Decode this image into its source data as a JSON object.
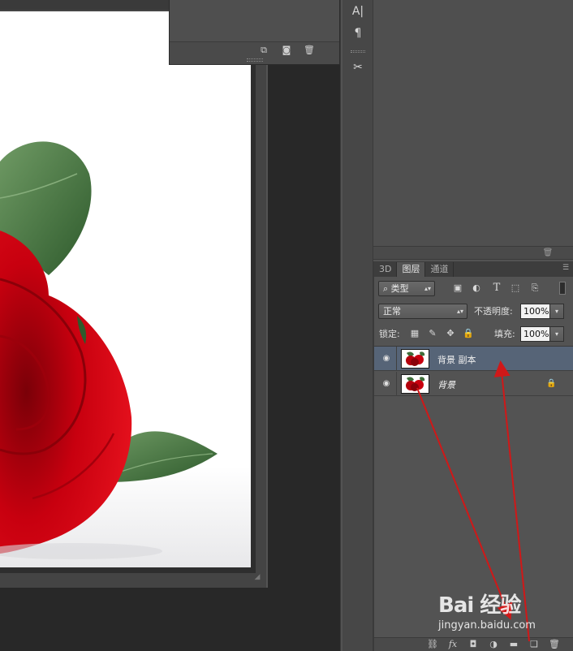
{
  "colors": {
    "panel": "#535353",
    "panel_dark": "#3d3d3d",
    "selected_layer": "#566477",
    "rose_red": "#c8000f",
    "leaf_green": "#3f6d3a",
    "annotation": "#d01818"
  },
  "history_panel": {
    "footer_icons": [
      "new-snapshot-icon",
      "camera-icon",
      "trash-icon"
    ]
  },
  "tool_strip": {
    "character_glyph": "A|",
    "paragraph_glyph": "¶",
    "tools_glyph": "✂"
  },
  "layers_panel": {
    "tabs": [
      {
        "label": "3D",
        "active": false
      },
      {
        "label": "图层",
        "active": true
      },
      {
        "label": "通道",
        "active": false
      }
    ],
    "filter": {
      "kind_label": "类型",
      "icons": [
        "image-filter-icon",
        "adjustment-filter-icon",
        "type-filter-icon",
        "shape-filter-icon",
        "smart-object-filter-icon"
      ]
    },
    "blend_mode": "正常",
    "opacity_label": "不透明度:",
    "opacity_value": "100%",
    "lock_label": "锁定:",
    "lock_icons": [
      "lock-transparent-icon",
      "lock-brush-icon",
      "lock-move-icon",
      "lock-all-icon"
    ],
    "fill_label": "填充:",
    "fill_value": "100%",
    "layers": [
      {
        "name": "背景 副本",
        "visible": true,
        "selected": true,
        "locked": false
      },
      {
        "name": "背景",
        "visible": true,
        "selected": false,
        "locked": true
      }
    ],
    "footer_icons": [
      "link-layers-icon",
      "fx-icon",
      "add-mask-icon",
      "adjustment-layer-icon",
      "new-group-icon",
      "new-layer-icon",
      "delete-layer-icon"
    ]
  },
  "watermark": {
    "logo": "Bai 经验",
    "sub": "jingyan.baidu.com"
  }
}
